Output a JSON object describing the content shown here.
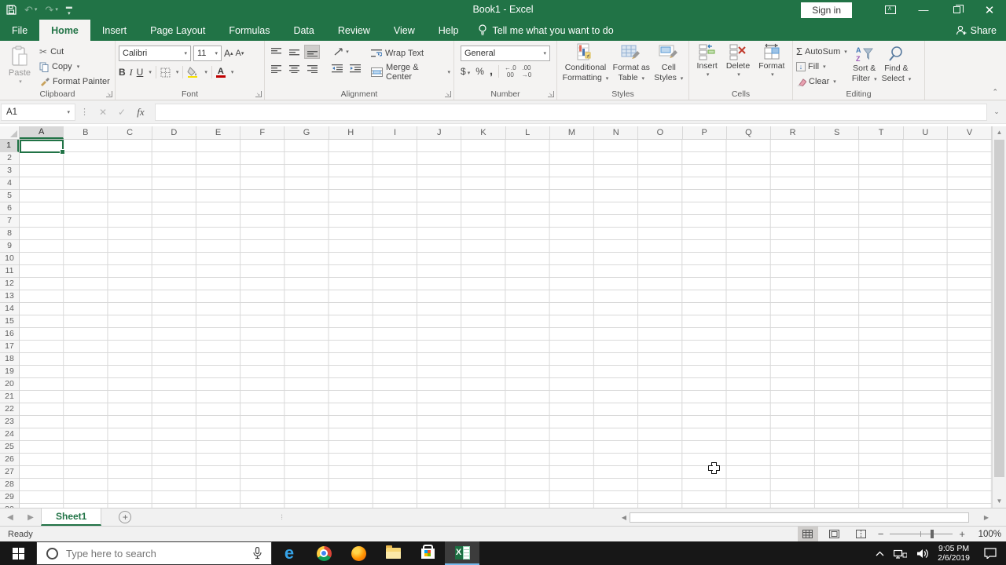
{
  "title_bar": {
    "title": "Book1  -  Excel",
    "sign_in_label": "Sign in",
    "qat_icons": [
      "save-icon",
      "undo-icon",
      "redo-icon",
      "customize-qat-icon"
    ],
    "window_icons": [
      "ribbon-display-options-icon",
      "minimize-icon",
      "restore-icon",
      "close-icon"
    ]
  },
  "ribbon": {
    "tabs": [
      {
        "label": "File",
        "active": false,
        "file": true
      },
      {
        "label": "Home",
        "active": true
      },
      {
        "label": "Insert"
      },
      {
        "label": "Page Layout"
      },
      {
        "label": "Formulas"
      },
      {
        "label": "Data"
      },
      {
        "label": "Review"
      },
      {
        "label": "View"
      },
      {
        "label": "Help"
      }
    ],
    "tell_me": "Tell me what you want to do",
    "share_label": "Share",
    "clipboard": {
      "label": "Clipboard",
      "paste": "Paste",
      "cut": "Cut",
      "copy": "Copy",
      "format_painter": "Format Painter"
    },
    "font": {
      "label": "Font",
      "font_name": "Calibri",
      "font_size": "11",
      "bold": "B",
      "italic": "I",
      "underline": "U"
    },
    "alignment": {
      "label": "Alignment",
      "wrap_text": "Wrap Text",
      "merge_center": "Merge & Center"
    },
    "number": {
      "label": "Number",
      "format": "General",
      "currency": "$",
      "percent": "%",
      "comma": ",",
      "inc_decimal": "←.0",
      "dec_decimal": ".00"
    },
    "styles": {
      "label": "Styles",
      "conditional_1": "Conditional",
      "conditional_2": "Formatting",
      "format_table_1": "Format as",
      "format_table_2": "Table",
      "cell_styles_1": "Cell",
      "cell_styles_2": "Styles"
    },
    "cells": {
      "label": "Cells",
      "insert": "Insert",
      "delete": "Delete",
      "format": "Format"
    },
    "editing": {
      "label": "Editing",
      "autosum": "AutoSum",
      "autosum_sigma": "Σ",
      "fill": "Fill",
      "clear": "Clear",
      "sort_1": "Sort &",
      "sort_2": "Filter",
      "find_1": "Find &",
      "find_2": "Select"
    }
  },
  "formula_bar": {
    "name_box": "A1",
    "fx": "fx",
    "formula_value": ""
  },
  "grid": {
    "columns": [
      "A",
      "B",
      "C",
      "D",
      "E",
      "F",
      "G",
      "H",
      "I",
      "J",
      "K",
      "L",
      "M",
      "N",
      "O",
      "P",
      "Q",
      "R",
      "S",
      "T",
      "U",
      "V"
    ],
    "row_count": 30,
    "selected_cell": "A1"
  },
  "sheet_bar": {
    "active_tab": "Sheet1",
    "add_sheet": "+"
  },
  "status_bar": {
    "status": "Ready",
    "views": [
      "normal-view-icon",
      "page-layout-view-icon",
      "page-break-preview-icon"
    ],
    "zoom_level": "100%"
  },
  "taskbar": {
    "search_placeholder": "Type here to search",
    "apps": [
      "edge",
      "chrome",
      "firefox",
      "explorer",
      "store",
      "excel"
    ],
    "active_app": "excel",
    "tray_icons": [
      "hidden-icons-chevron",
      "network-icon",
      "volume-icon",
      "action-center-icon"
    ],
    "time": "9:05 PM",
    "date": "2/6/2019"
  },
  "colors": {
    "excel_green": "#217346",
    "selection_border": "#217346",
    "fill_yellow": "#f7e000",
    "font_color_red": "#c00000"
  }
}
